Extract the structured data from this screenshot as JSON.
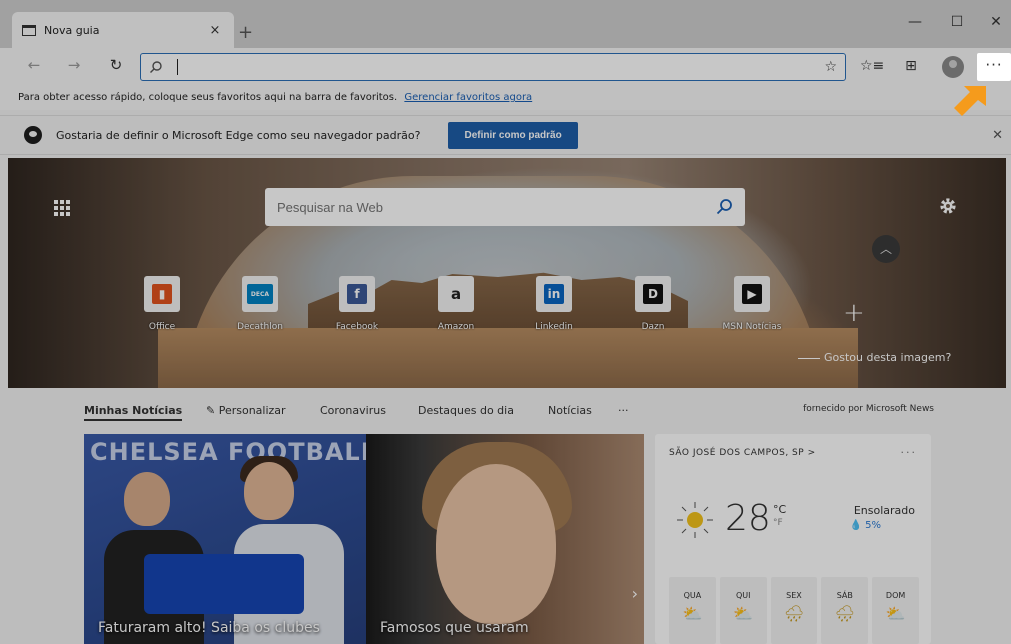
{
  "tab": {
    "title": "Nova guia",
    "close": "×"
  },
  "window": {
    "new_tab": "+",
    "minimize": "—",
    "maximize": "☐",
    "close": "✕"
  },
  "toolbar": {
    "back": "←",
    "forward": "→",
    "refresh": "↻",
    "address_value": "",
    "star": "☆",
    "favorites": "☆≡",
    "collections": "⊞",
    "more": "···"
  },
  "favorites_bar": {
    "text": "Para obter acesso rápido, coloque seus favoritos aqui na barra de favoritos.",
    "link": "Gerenciar favoritos agora"
  },
  "default_bar": {
    "message": "Gostaria de definir o Microsoft Edge como seu navegador padrão?",
    "button": "Definir como padrão",
    "close": "✕"
  },
  "hero": {
    "search_placeholder": "Pesquisar na Web",
    "like_image": "Gostou desta imagem?",
    "tiles": [
      {
        "label": "Office",
        "glyph": "▮",
        "color": "#e2531e"
      },
      {
        "label": "Decathlon",
        "glyph": "DECA",
        "color": "#0082c3"
      },
      {
        "label": "Facebook",
        "glyph": "f",
        "color": "#3b5998"
      },
      {
        "label": "Amazon",
        "glyph": "a",
        "color": "#222222"
      },
      {
        "label": "Linkedin",
        "glyph": "in",
        "color": "#0a66c2"
      },
      {
        "label": "Dazn",
        "glyph": "D",
        "color": "#111111"
      },
      {
        "label": "MSN Notícias",
        "glyph": "▶",
        "color": "#111111"
      }
    ]
  },
  "news_nav": {
    "my_news": "Minhas Notícias",
    "personalize": "✎ Personalizar",
    "coronavirus": "Coronavirus",
    "highlights": "Destaques do dia",
    "news": "Notícias",
    "more": "···",
    "provider": "fornecido por Microsoft News"
  },
  "cards": [
    {
      "brand": "CHELSEA FOOTBALL C",
      "headline": "Faturaram alto! Saiba os clubes"
    },
    {
      "headline": "Famosos que usaram"
    }
  ],
  "weather": {
    "location": "SÃO JOSÉ DOS CAMPOS, SP  >",
    "more": "···",
    "temp": "28",
    "unit_c": "°C",
    "unit_f": "°F",
    "condition": "Ensolarado",
    "rain": "💧 5%",
    "days": [
      "QUA",
      "QUI",
      "SEX",
      "SÁB",
      "DOM"
    ],
    "day_icons": [
      "⛅",
      "⛅",
      "🌧",
      "🌧",
      "⛅"
    ]
  },
  "colors": {
    "accent": "#1e5ea8",
    "highlight_arrow": "#f59b1c"
  }
}
